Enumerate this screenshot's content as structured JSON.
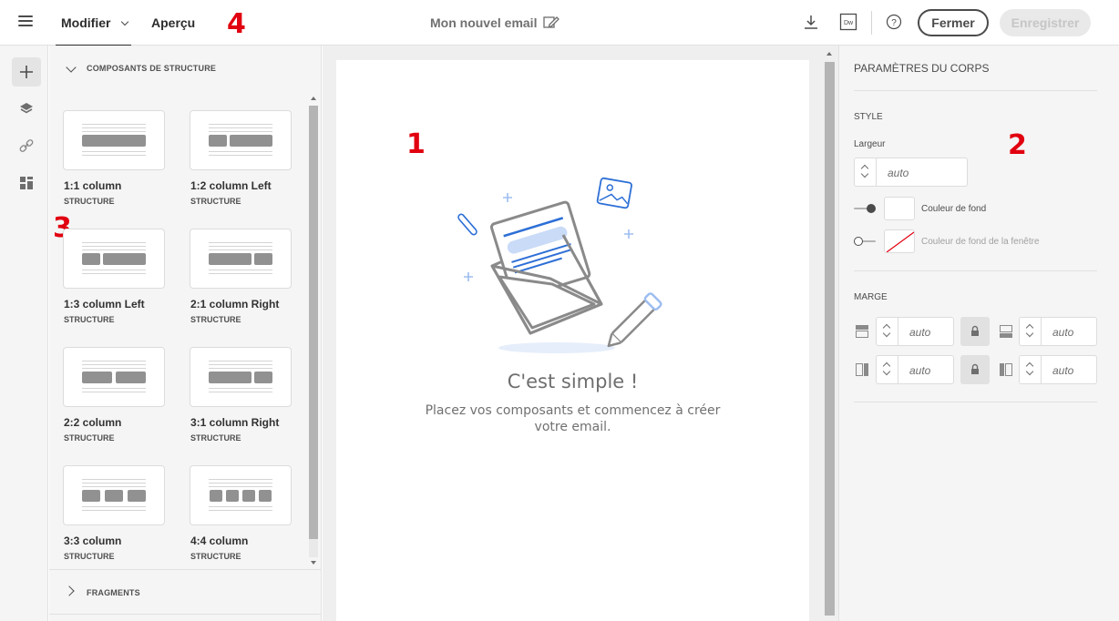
{
  "header": {
    "tabs": [
      {
        "label": "Modifier"
      },
      {
        "label": "Aperçu"
      }
    ],
    "document_title": "Mon nouvel email",
    "close_label": "Fermer",
    "save_label": "Enregistrer",
    "icons": [
      "menu-icon",
      "chevron-down-icon",
      "edit-icon",
      "download-icon",
      "dreamweaver-icon",
      "help-icon"
    ]
  },
  "markers": [
    "1",
    "2",
    "3",
    "4"
  ],
  "rail": {
    "items": [
      "add-icon",
      "layers-icon",
      "link-icon",
      "fragments-icon"
    ]
  },
  "components": {
    "section_title": "COMPOSANTS DE STRUCTURE",
    "items": [
      {
        "name": "1:1 column",
        "type": "STRUCTURE"
      },
      {
        "name": "1:2 column Left",
        "type": "STRUCTURE"
      },
      {
        "name": "1:3 column Left",
        "type": "STRUCTURE"
      },
      {
        "name": "2:1 column Right",
        "type": "STRUCTURE"
      },
      {
        "name": "2:2 column",
        "type": "STRUCTURE"
      },
      {
        "name": "3:1 column Right",
        "type": "STRUCTURE"
      },
      {
        "name": "3:3 column",
        "type": "STRUCTURE"
      },
      {
        "name": "4:4 column",
        "type": "STRUCTURE"
      }
    ],
    "fragments_title": "FRAGMENTS"
  },
  "canvas": {
    "empty_title": "C'est simple !",
    "empty_description": "Placez vos composants et commencez à créer votre email."
  },
  "properties": {
    "title": "PARAMÈTRES DU CORPS",
    "style_section": "STYLE",
    "width_label": "Largeur",
    "width_value": "auto",
    "bg_color_label": "Couleur de fond",
    "window_bg_color_label": "Couleur de fond de la fenêtre",
    "margin_section": "MARGE",
    "margin_top": "auto",
    "margin_bottom": "auto",
    "margin_left": "auto",
    "margin_right": "auto"
  },
  "colors": {
    "accent_marker": "#e1000f",
    "illustration_blue": "#2d6fd6",
    "illustration_gray": "#8a8a8a"
  }
}
